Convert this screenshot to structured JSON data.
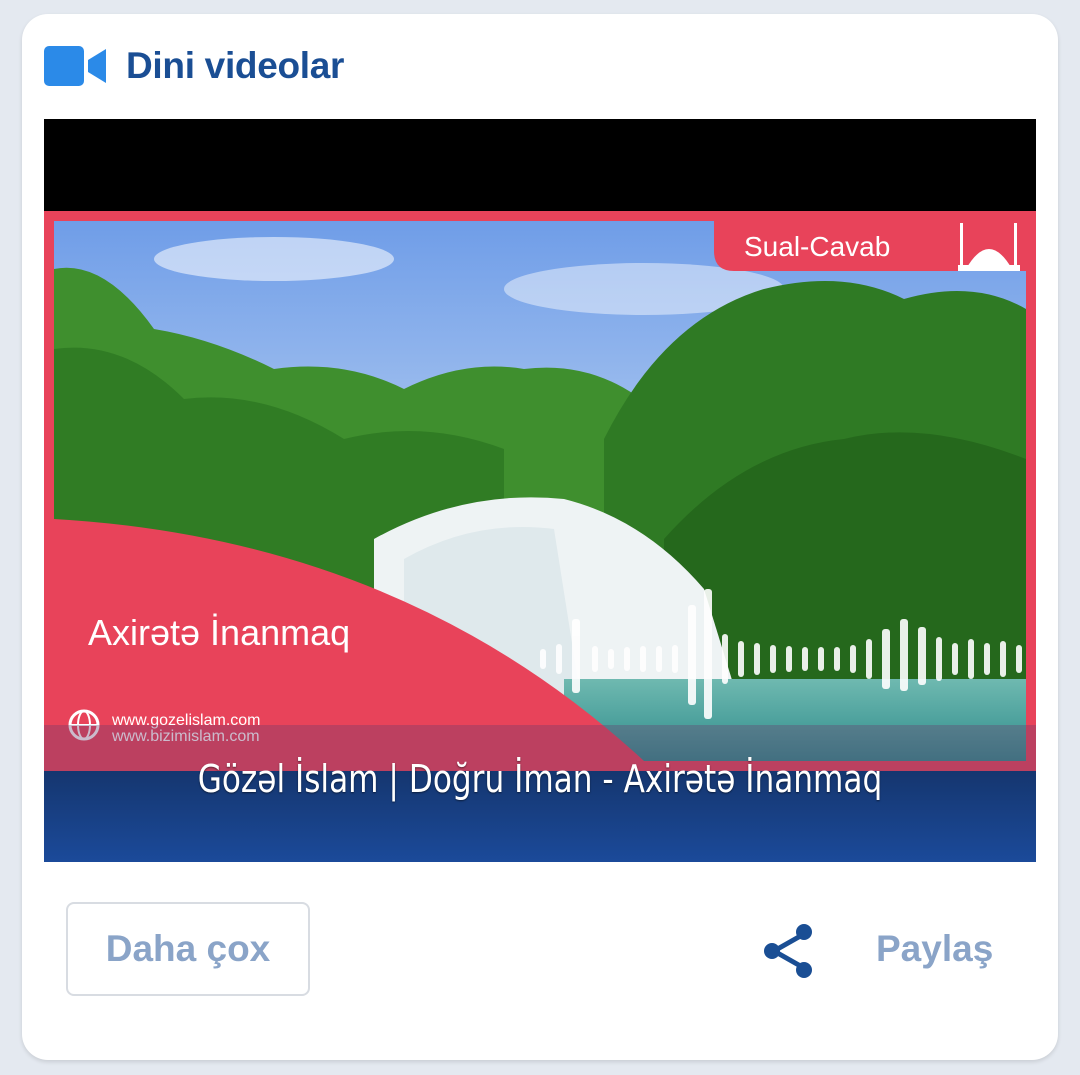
{
  "header": {
    "title": "Dini videolar",
    "icon": "video-camera-icon",
    "accent_color": "#2b8ae8",
    "title_color": "#1a4e94"
  },
  "video": {
    "thumbnail": {
      "badge": "Sual-Cavab",
      "overlay_title": "Axirətə İnanmaq",
      "url_1": "www.gozelislam.com",
      "url_2": "www.bizimislam.com",
      "frame_color": "#e8435a"
    },
    "caption": "Gözəl İslam | Doğru İman - Axirətə İnanmaq"
  },
  "actions": {
    "more_label": "Daha çox",
    "share_label": "Paylaş",
    "share_icon": "share-icon",
    "share_icon_color": "#1a4e94",
    "label_color": "#8aa4c8"
  }
}
